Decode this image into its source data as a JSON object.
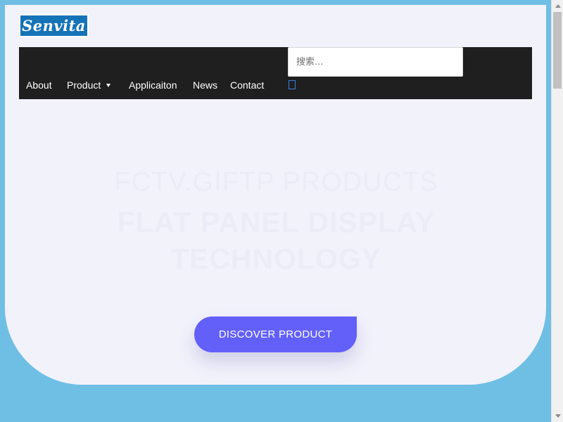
{
  "brand": {
    "logo_text": "Senvita"
  },
  "nav": {
    "items": [
      {
        "label": "About"
      },
      {
        "label": "Product"
      },
      {
        "label": "Applicaiton"
      },
      {
        "label": "News"
      },
      {
        "label": "Contact"
      }
    ]
  },
  "search": {
    "placeholder": "搜索...",
    "icon": "search-icon"
  },
  "hero": {
    "subtitle": "FCTV.GIFTP PRODUCTS",
    "title_line1": "FLAT PANEL DISPLAY",
    "title_line2": "TECHNOLOGY",
    "button_label": "DISCOVER PRODUCT"
  },
  "colors": {
    "background": "#6fbfe5",
    "card": "#f2f2fb",
    "nav": "#1f1f1f",
    "button": "#6360fa",
    "logo": "#1573b7"
  }
}
